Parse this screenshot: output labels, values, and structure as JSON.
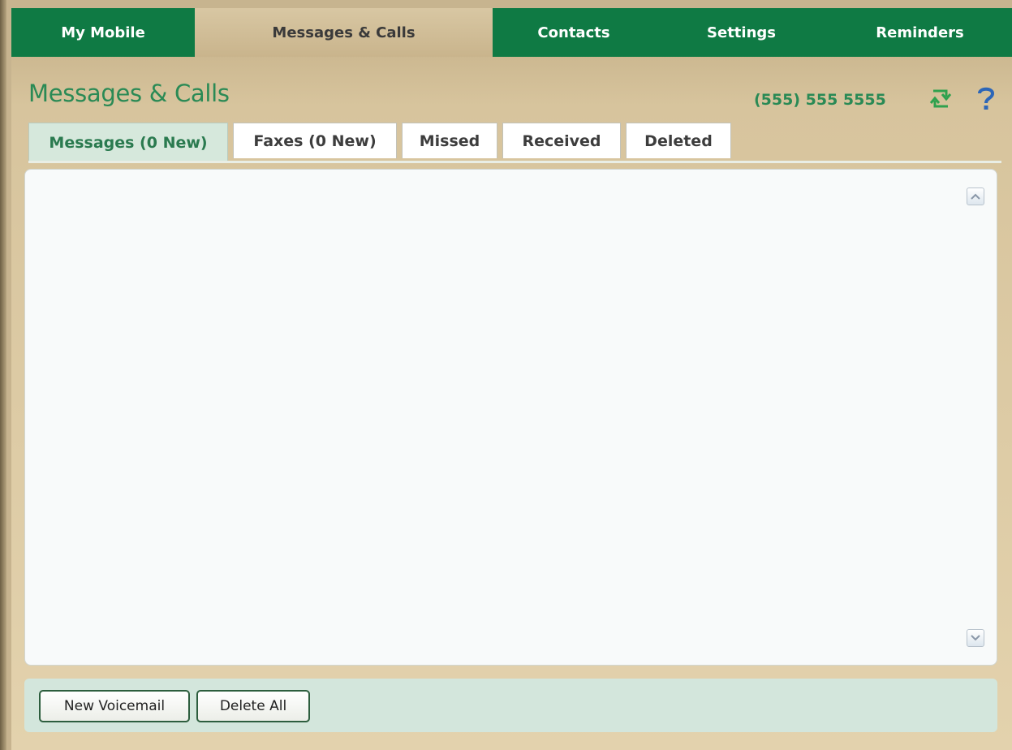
{
  "nav": {
    "tabs": [
      {
        "label": "My Mobile"
      },
      {
        "label": "Messages & Calls",
        "active": true
      },
      {
        "label": "Contacts"
      },
      {
        "label": "Settings"
      },
      {
        "label": "Reminders"
      }
    ]
  },
  "header": {
    "title": "Messages & Calls",
    "phone": "(555) 555 5555",
    "icons": [
      "refresh-icon",
      "help-icon"
    ]
  },
  "subtabs": [
    {
      "label": "Messages (0 New)",
      "active": true
    },
    {
      "label": "Faxes (0 New)"
    },
    {
      "label": "Missed"
    },
    {
      "label": "Received"
    },
    {
      "label": "Deleted"
    }
  ],
  "footer": {
    "new_voicemail_label": "New Voicemail",
    "delete_all_label": "Delete All"
  },
  "colors": {
    "nav_green": "#0f7a44",
    "title_green": "#2a8a55",
    "background_tan": "#d7c49d",
    "footer_mint": "#d3e6dc"
  }
}
